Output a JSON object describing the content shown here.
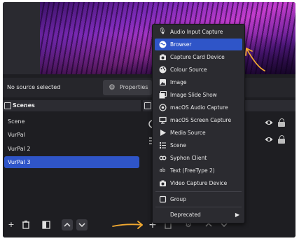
{
  "source_bar": {
    "status": "No source selected",
    "properties_label": "Properties",
    "properties_icon": "gear-icon"
  },
  "scenes": {
    "title": "Scenes",
    "items": [
      {
        "label": "Scene",
        "selected": false
      },
      {
        "label": "VurPal",
        "selected": false
      },
      {
        "label": "VurPal 2",
        "selected": false
      },
      {
        "label": "VurPal 3",
        "selected": true
      }
    ],
    "toolbar": [
      "add-icon",
      "trash-icon",
      "filter-icon",
      "chevron-up-icon",
      "chevron-down-icon"
    ]
  },
  "sources": {
    "toolbar": [
      "add-icon",
      "trash-icon",
      "gear-icon",
      "chevron-up-icon",
      "chevron-down-icon"
    ]
  },
  "add_source_menu": {
    "items": [
      {
        "label": "Audio Input Capture",
        "icon": "microphone-icon"
      },
      {
        "label": "Browser",
        "icon": "globe-icon",
        "highlighted": true
      },
      {
        "label": "Capture Card Device",
        "icon": "camera-icon"
      },
      {
        "label": "Colour Source",
        "icon": "palette-icon"
      },
      {
        "label": "Image",
        "icon": "image-icon"
      },
      {
        "label": "Image Slide Show",
        "icon": "slideshow-icon"
      },
      {
        "label": "macOS Audio Capture",
        "icon": "audio-icon"
      },
      {
        "label": "macOS Screen Capture",
        "icon": "monitor-icon"
      },
      {
        "label": "Media Source",
        "icon": "play-icon"
      },
      {
        "label": "Scene",
        "icon": "list-icon"
      },
      {
        "label": "Syphon Client",
        "icon": "link-icon"
      },
      {
        "label": "Text (FreeType 2)",
        "icon": "text-icon"
      },
      {
        "label": "Video Capture Device",
        "icon": "camera-icon"
      }
    ],
    "group_label": "Group",
    "group_icon": "folder-icon",
    "deprecated_label": "Deprecated"
  },
  "colors": {
    "highlight": "#2f55c8",
    "annotation_arrow": "#f0a830",
    "panel_bg": "#1e1e22"
  }
}
